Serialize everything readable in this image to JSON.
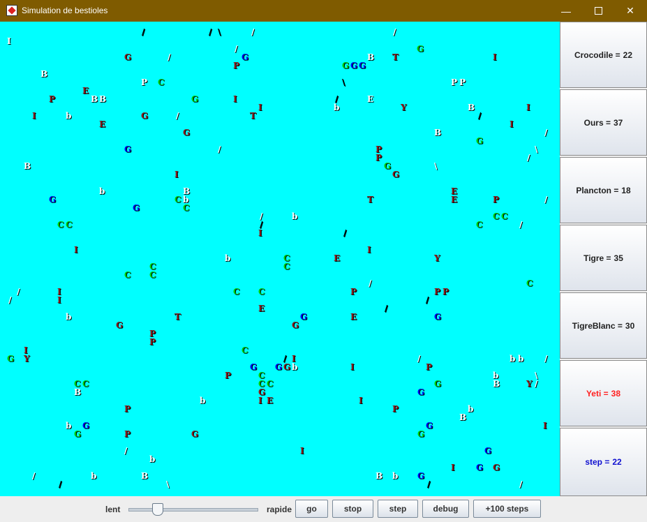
{
  "window": {
    "title": "Simulation de bestioles",
    "minimize_icon": "minimize-icon",
    "maximize_icon": "maximize-icon",
    "close_icon": "close-icon"
  },
  "colors": {
    "titlebar": "#7f5b00",
    "world_bg": "#00ffff",
    "yeti_text": "#ff2020",
    "step_text": "#1010d0",
    "green": "#00cc00",
    "blue": "#0000ee",
    "brown": "#8b1a1a",
    "white": "#ffffff",
    "black": "#000000"
  },
  "stats": [
    {
      "label": "Crocodile = ",
      "value": "22",
      "color": "#222222"
    },
    {
      "label": "Ours = ",
      "value": "37",
      "color": "#222222"
    },
    {
      "label": "Plancton = ",
      "value": "18",
      "color": "#222222"
    },
    {
      "label": "Tigre = ",
      "value": "35",
      "color": "#222222"
    },
    {
      "label": "TigreBlanc = ",
      "value": "30",
      "color": "#222222"
    },
    {
      "label": "Yeti = ",
      "value": "38",
      "color": "#ff2020"
    },
    {
      "label": "step = ",
      "value": "22",
      "color": "#1010d0"
    }
  ],
  "controls": {
    "slow_label": "lent",
    "fast_label": "rapide",
    "speed_level": 0.2,
    "buttons": [
      "go",
      "stop",
      "step",
      "debug",
      "+100 steps"
    ]
  },
  "creatures": [
    [
      "I",
      10,
      22,
      "w"
    ],
    [
      "/",
      203,
      9,
      "k"
    ],
    [
      "/",
      299,
      9,
      "k"
    ],
    [
      "\\",
      312,
      9,
      "k"
    ],
    [
      "/",
      360,
      9,
      "w"
    ],
    [
      "/",
      563,
      9,
      "w"
    ],
    [
      "G",
      597,
      33,
      "g"
    ],
    [
      "G",
      178,
      45,
      "r"
    ],
    [
      "/",
      240,
      45,
      "w"
    ],
    [
      "/",
      336,
      33,
      "w"
    ],
    [
      "G",
      346,
      45,
      "b"
    ],
    [
      "B",
      526,
      45,
      "w"
    ],
    [
      "T",
      562,
      45,
      "r"
    ],
    [
      "I",
      706,
      45,
      "r"
    ],
    [
      "P",
      334,
      57,
      "r"
    ],
    [
      "G",
      490,
      57,
      "g"
    ],
    [
      "G",
      502,
      57,
      "b"
    ],
    [
      "G",
      514,
      57,
      "b"
    ],
    [
      "B",
      58,
      69,
      "w"
    ],
    [
      "P",
      202,
      81,
      "w"
    ],
    [
      "C",
      226,
      81,
      "g"
    ],
    [
      "\\",
      490,
      81,
      "k"
    ],
    [
      "P",
      646,
      81,
      "w"
    ],
    [
      "P",
      658,
      81,
      "w"
    ],
    [
      "E",
      118,
      93,
      "r"
    ],
    [
      "P",
      70,
      105,
      "r"
    ],
    [
      "B",
      130,
      105,
      "w"
    ],
    [
      "B",
      142,
      105,
      "w"
    ],
    [
      "G",
      274,
      105,
      "g"
    ],
    [
      "I",
      334,
      105,
      "r"
    ],
    [
      "/",
      480,
      105,
      "k"
    ],
    [
      "E",
      526,
      105,
      "w"
    ],
    [
      "I",
      370,
      117,
      "r"
    ],
    [
      "b",
      478,
      117,
      "w"
    ],
    [
      "Y",
      574,
      117,
      "r"
    ],
    [
      "B",
      670,
      117,
      "w"
    ],
    [
      "I",
      754,
      117,
      "r"
    ],
    [
      "I",
      46,
      129,
      "r"
    ],
    [
      "b",
      94,
      129,
      "w"
    ],
    [
      "G",
      202,
      129,
      "r"
    ],
    [
      "/",
      252,
      129,
      "w"
    ],
    [
      "T",
      358,
      129,
      "r"
    ],
    [
      "/",
      685,
      129,
      "k"
    ],
    [
      "E",
      142,
      141,
      "r"
    ],
    [
      "I",
      730,
      141,
      "r"
    ],
    [
      "G",
      262,
      153,
      "r"
    ],
    [
      "B",
      622,
      153,
      "w"
    ],
    [
      "/",
      780,
      153,
      "w"
    ],
    [
      "G",
      682,
      165,
      "g"
    ],
    [
      "G",
      178,
      177,
      "b"
    ],
    [
      "/",
      312,
      177,
      "w"
    ],
    [
      "P",
      538,
      177,
      "r"
    ],
    [
      "\\",
      766,
      177,
      "w"
    ],
    [
      "P",
      538,
      189,
      "r"
    ],
    [
      "/",
      755,
      189,
      "w"
    ],
    [
      "B",
      34,
      201,
      "w"
    ],
    [
      "G",
      550,
      201,
      "g"
    ],
    [
      "\\",
      622,
      201,
      "w"
    ],
    [
      "I",
      250,
      213,
      "r"
    ],
    [
      "G",
      562,
      213,
      "r"
    ],
    [
      "b",
      142,
      237,
      "w"
    ],
    [
      "B",
      262,
      237,
      "w"
    ],
    [
      "E",
      646,
      237,
      "r"
    ],
    [
      "G",
      70,
      249,
      "b"
    ],
    [
      "C",
      250,
      249,
      "g"
    ],
    [
      "b",
      262,
      249,
      "w"
    ],
    [
      "T",
      526,
      249,
      "r"
    ],
    [
      "E",
      646,
      249,
      "r"
    ],
    [
      "P",
      706,
      249,
      "r"
    ],
    [
      "/",
      780,
      249,
      "w"
    ],
    [
      "G",
      190,
      261,
      "b"
    ],
    [
      "C",
      262,
      261,
      "g"
    ],
    [
      "/",
      372,
      273,
      "w"
    ],
    [
      "b",
      418,
      273,
      "w"
    ],
    [
      "C",
      706,
      273,
      "g"
    ],
    [
      "C",
      718,
      273,
      "g"
    ],
    [
      "C",
      82,
      285,
      "g"
    ],
    [
      "C",
      94,
      285,
      "g"
    ],
    [
      "/",
      372,
      285,
      "k"
    ],
    [
      "C",
      682,
      285,
      "g"
    ],
    [
      "/",
      744,
      285,
      "w"
    ],
    [
      "I",
      370,
      297,
      "r"
    ],
    [
      "/",
      492,
      297,
      "k"
    ],
    [
      "I",
      106,
      321,
      "r"
    ],
    [
      "I",
      526,
      321,
      "r"
    ],
    [
      "b",
      322,
      333,
      "w"
    ],
    [
      "C",
      406,
      333,
      "g"
    ],
    [
      "E",
      478,
      333,
      "r"
    ],
    [
      "Y",
      622,
      333,
      "r"
    ],
    [
      "C",
      214,
      345,
      "g"
    ],
    [
      "C",
      406,
      345,
      "g"
    ],
    [
      "C",
      178,
      357,
      "g"
    ],
    [
      "C",
      214,
      357,
      "g"
    ],
    [
      "/",
      528,
      369,
      "w"
    ],
    [
      "C",
      754,
      369,
      "g"
    ],
    [
      "/",
      24,
      381,
      "w"
    ],
    [
      "I",
      82,
      381,
      "r"
    ],
    [
      "C",
      334,
      381,
      "g"
    ],
    [
      "C",
      370,
      381,
      "g"
    ],
    [
      "P",
      502,
      381,
      "r"
    ],
    [
      "P",
      622,
      381,
      "r"
    ],
    [
      "P",
      634,
      381,
      "r"
    ],
    [
      "/",
      12,
      393,
      "w"
    ],
    [
      "I",
      82,
      393,
      "r"
    ],
    [
      "/",
      610,
      393,
      "k"
    ],
    [
      "E",
      370,
      405,
      "r"
    ],
    [
      "/",
      551,
      405,
      "k"
    ],
    [
      "b",
      94,
      417,
      "w"
    ],
    [
      "T",
      250,
      417,
      "r"
    ],
    [
      "G",
      430,
      417,
      "b"
    ],
    [
      "E",
      502,
      417,
      "r"
    ],
    [
      "G",
      622,
      417,
      "b"
    ],
    [
      "G",
      166,
      429,
      "r"
    ],
    [
      "G",
      418,
      429,
      "r"
    ],
    [
      "P",
      214,
      441,
      "r"
    ],
    [
      "P",
      214,
      453,
      "r"
    ],
    [
      "I",
      34,
      465,
      "r"
    ],
    [
      "C",
      346,
      465,
      "g"
    ],
    [
      "G",
      10,
      477,
      "g"
    ],
    [
      "Y",
      34,
      477,
      "r"
    ],
    [
      "/",
      406,
      477,
      "k"
    ],
    [
      "I",
      418,
      477,
      "r"
    ],
    [
      "/",
      598,
      477,
      "w"
    ],
    [
      "b",
      730,
      477,
      "w"
    ],
    [
      "b",
      742,
      477,
      "w"
    ],
    [
      "/",
      780,
      477,
      "w"
    ],
    [
      "G",
      358,
      489,
      "b"
    ],
    [
      "G",
      394,
      489,
      "b"
    ],
    [
      "G",
      406,
      489,
      "r"
    ],
    [
      "b",
      418,
      489,
      "w"
    ],
    [
      "I",
      502,
      489,
      "r"
    ],
    [
      "P",
      610,
      489,
      "r"
    ],
    [
      "P",
      322,
      501,
      "r"
    ],
    [
      "C",
      370,
      501,
      "g"
    ],
    [
      "b",
      706,
      501,
      "w"
    ],
    [
      "\\",
      766,
      501,
      "w"
    ],
    [
      "C",
      106,
      513,
      "g"
    ],
    [
      "C",
      118,
      513,
      "g"
    ],
    [
      "C",
      370,
      513,
      "g"
    ],
    [
      "C",
      382,
      513,
      "g"
    ],
    [
      "G",
      622,
      513,
      "g"
    ],
    [
      "B",
      706,
      513,
      "w"
    ],
    [
      "Y",
      754,
      513,
      "r"
    ],
    [
      "/",
      766,
      513,
      "w"
    ],
    [
      "B",
      106,
      525,
      "w"
    ],
    [
      "G",
      370,
      525,
      "r"
    ],
    [
      "G",
      598,
      525,
      "b"
    ],
    [
      "b",
      286,
      537,
      "w"
    ],
    [
      "I",
      370,
      537,
      "r"
    ],
    [
      "E",
      382,
      537,
      "r"
    ],
    [
      "I",
      514,
      537,
      "r"
    ],
    [
      "P",
      178,
      549,
      "r"
    ],
    [
      "P",
      562,
      549,
      "r"
    ],
    [
      "b",
      670,
      549,
      "w"
    ],
    [
      "B",
      658,
      561,
      "w"
    ],
    [
      "b",
      94,
      573,
      "w"
    ],
    [
      "G",
      118,
      573,
      "b"
    ],
    [
      "G",
      610,
      573,
      "b"
    ],
    [
      "I",
      778,
      573,
      "r"
    ],
    [
      "G",
      106,
      585,
      "g"
    ],
    [
      "P",
      178,
      585,
      "r"
    ],
    [
      "G",
      274,
      585,
      "r"
    ],
    [
      "G",
      598,
      585,
      "g"
    ],
    [
      "/",
      178,
      609,
      "w"
    ],
    [
      "I",
      430,
      609,
      "r"
    ],
    [
      "G",
      694,
      609,
      "b"
    ],
    [
      "b",
      214,
      621,
      "w"
    ],
    [
      "I",
      646,
      633,
      "r"
    ],
    [
      "G",
      682,
      633,
      "b"
    ],
    [
      "G",
      706,
      633,
      "r"
    ],
    [
      "/",
      46,
      645,
      "w"
    ],
    [
      "b",
      130,
      645,
      "w"
    ],
    [
      "B",
      202,
      645,
      "w"
    ],
    [
      "B",
      538,
      645,
      "w"
    ],
    [
      "b",
      562,
      645,
      "w"
    ],
    [
      "G",
      598,
      645,
      "b"
    ],
    [
      "/",
      84,
      657,
      "k"
    ],
    [
      "\\",
      238,
      657,
      "w"
    ],
    [
      "/",
      612,
      657,
      "k"
    ],
    [
      "/",
      744,
      657,
      "w"
    ]
  ]
}
